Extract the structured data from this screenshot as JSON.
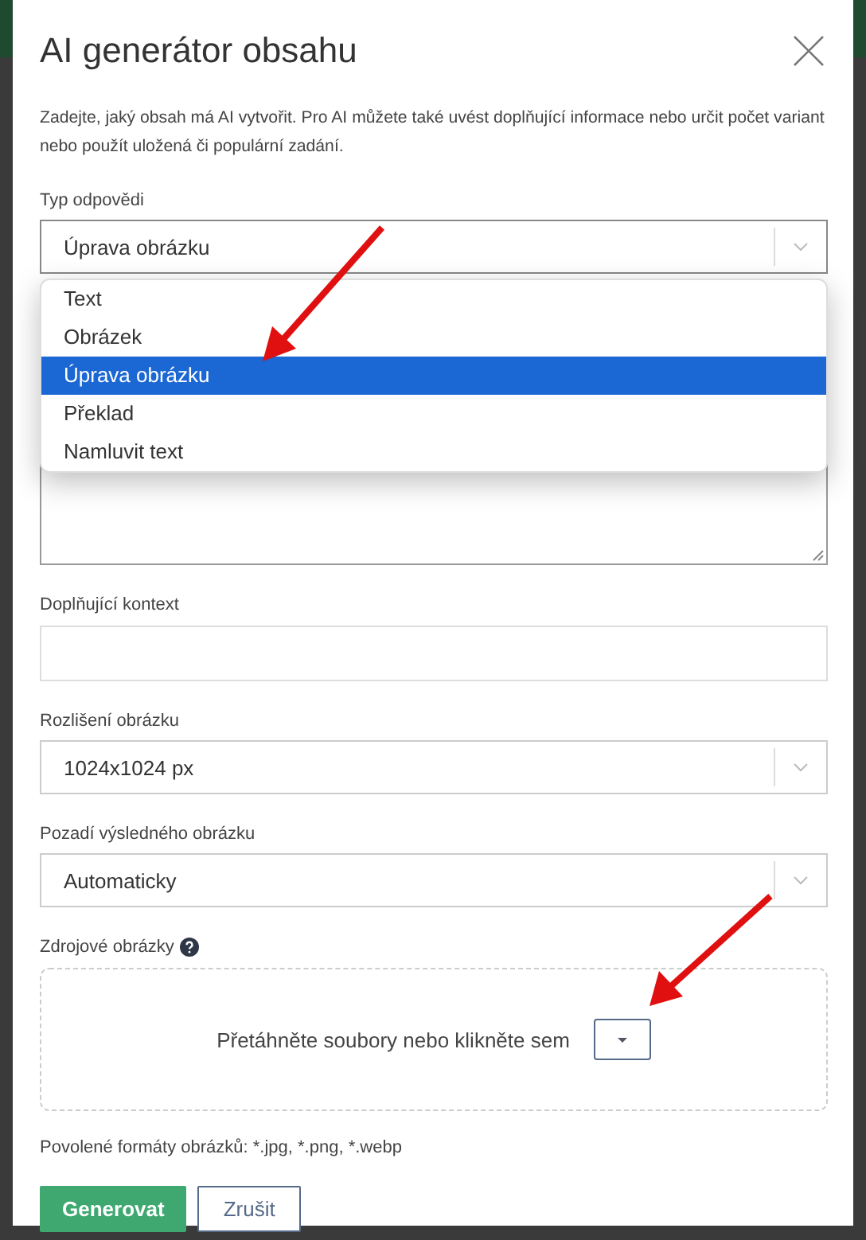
{
  "dialog": {
    "title": "AI generátor obsahu",
    "description": "Zadejte, jaký obsah má AI vytvořit. Pro AI můžete také uvést doplňující informace nebo určit počet variant nebo použít uložená či populární zadání."
  },
  "fields": [
    {
      "kind": "select",
      "label": "Typ odpovědi",
      "value": "Úprava obrázku",
      "expanded": true,
      "options": [
        {
          "label": "Text",
          "selected": false
        },
        {
          "label": "Obrázek",
          "selected": false
        },
        {
          "label": "Úprava obrázku",
          "selected": true
        },
        {
          "label": "Překlad",
          "selected": false
        },
        {
          "label": "Namluvit text",
          "selected": false
        }
      ]
    },
    {
      "kind": "textarea"
    },
    {
      "kind": "input",
      "label": "Doplňující kontext"
    },
    {
      "kind": "select",
      "label": "Rozlišení obrázku",
      "value": "1024x1024 px",
      "expanded": false
    },
    {
      "kind": "select",
      "label": "Pozadí výsledného obrázku",
      "value": "Automaticky",
      "expanded": false
    },
    {
      "kind": "dropzone",
      "label": "Zdrojové obrázky",
      "prompt": "Přetáhněte soubory nebo klikněte sem"
    }
  ],
  "note": "Povolené formáty obrázků: *.jpg, *.png, *.webp",
  "buttons": [
    {
      "label": "Generovat",
      "kind": "primary"
    },
    {
      "label": "Zrušit",
      "kind": "secondary"
    }
  ]
}
